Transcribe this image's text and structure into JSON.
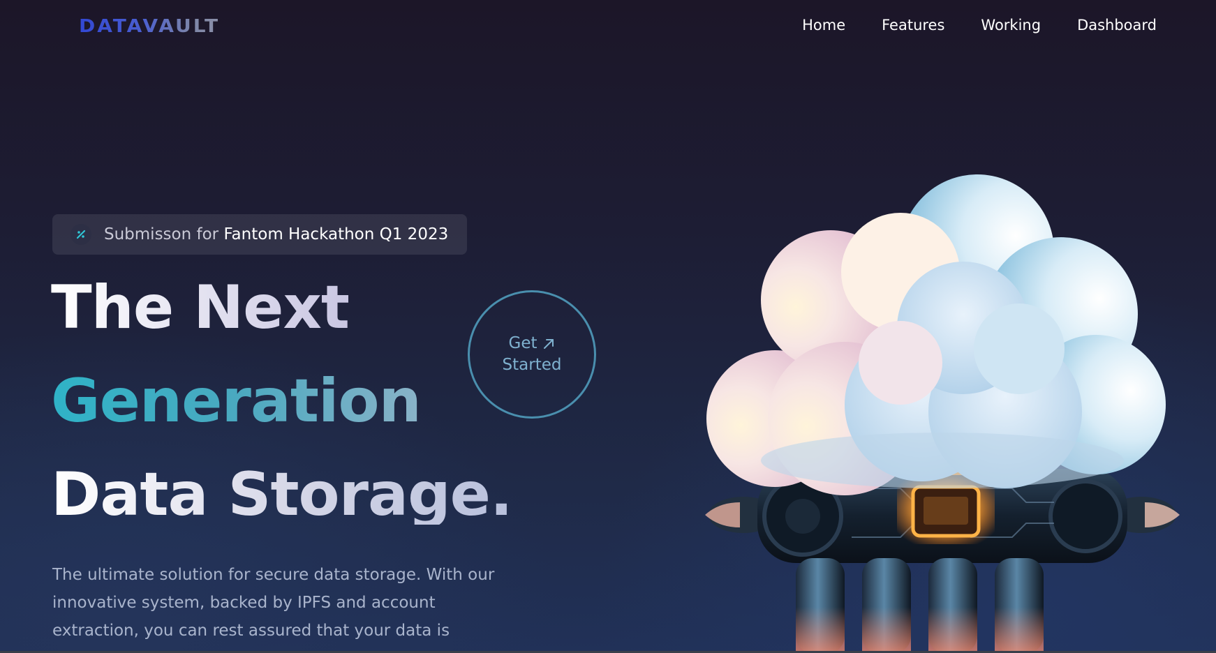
{
  "header": {
    "logo_text": "DATAVAULT",
    "nav": [
      {
        "label": "Home"
      },
      {
        "label": "Features"
      },
      {
        "label": "Working"
      },
      {
        "label": "Dashboard"
      }
    ]
  },
  "hero": {
    "badge": {
      "icon": "fantom-logo-icon",
      "prefix": "Submisson for ",
      "highlight": "Fantom Hackathon Q1 2023"
    },
    "headline": {
      "line1": "The Next",
      "line2": "Generation",
      "line3": "Data Storage."
    },
    "cta": {
      "line1": "Get",
      "line2": "Started",
      "icon": "arrow-up-right-icon"
    },
    "description": "The ultimate solution for secure data storage. With our innovative system, backed by IPFS and account extraction, you can rest assured that your data is",
    "illustration": "cloud-chip-icon"
  },
  "colors": {
    "background": "#1b1a30",
    "accent_teal": "#2fb3c7",
    "logo_blue": "#3248d4",
    "cta_border": "#4a8fae"
  }
}
